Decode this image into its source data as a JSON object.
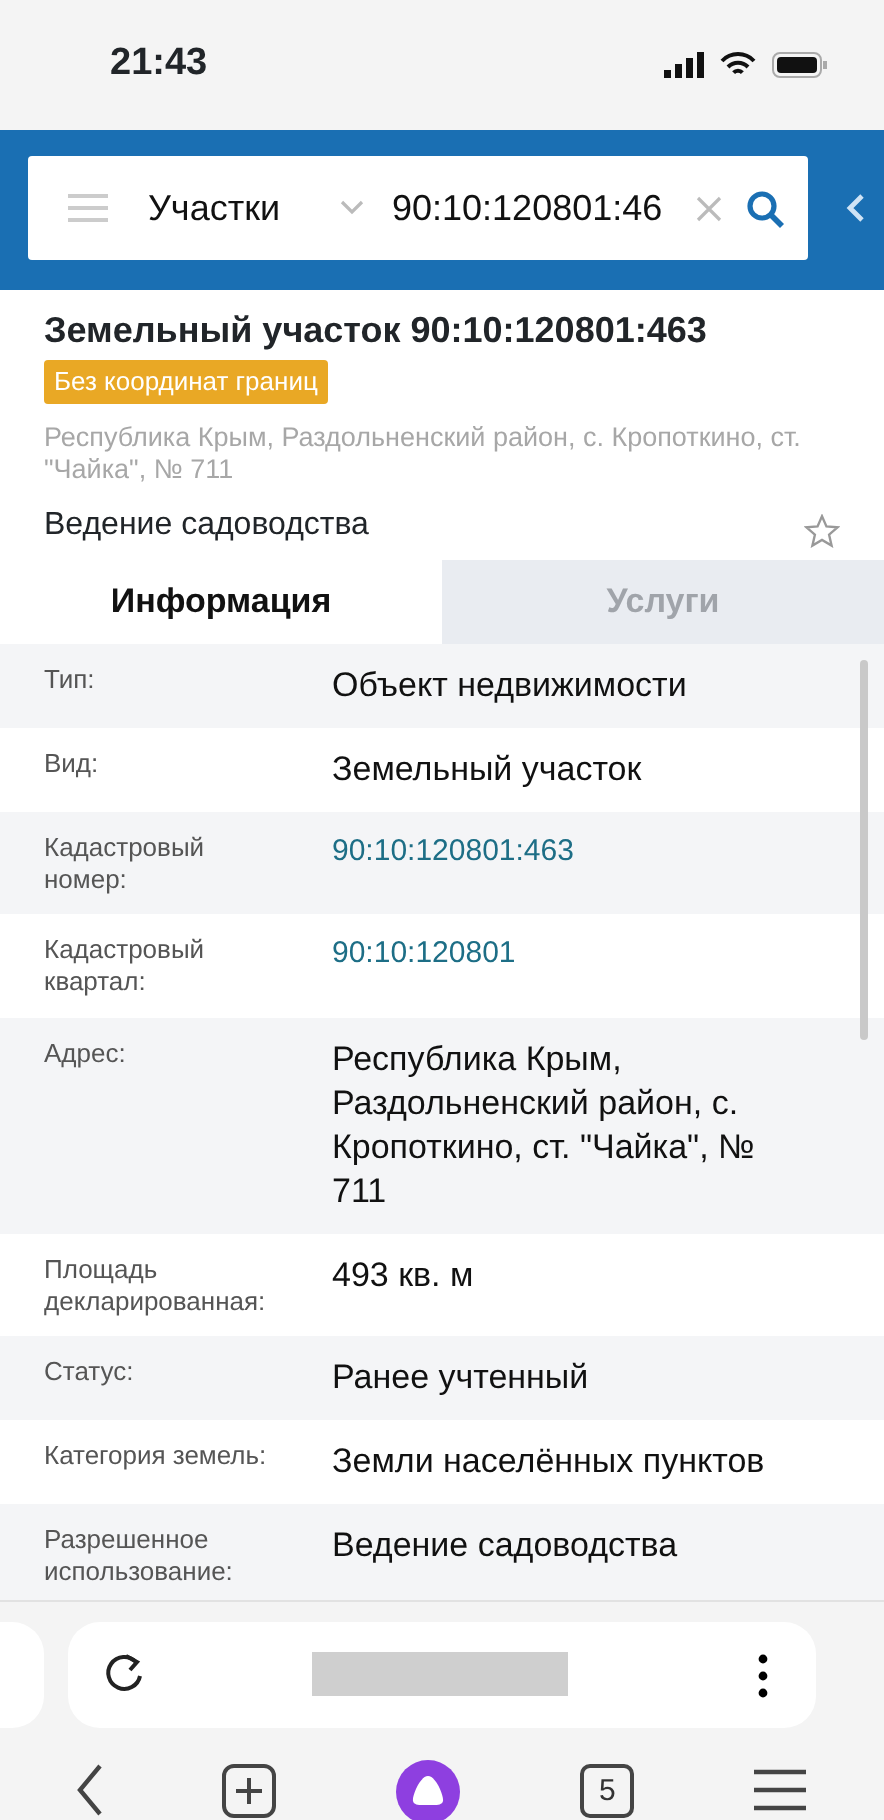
{
  "status_bar": {
    "time": "21:43"
  },
  "search": {
    "category": "Участки",
    "query": "90:10:120801:46"
  },
  "object": {
    "title": "Земельный участок 90:10:120801:463",
    "badge": "Без координат границ",
    "address": "Республика Крым, Раздольненский район, с. Кропоткино, ст. \"Чайка\", № 711",
    "usage": "Ведение садоводства",
    "favorite": false
  },
  "tabs": [
    {
      "label": "Информация",
      "selected": true
    },
    {
      "label": "Услуги",
      "selected": false
    }
  ],
  "rows": [
    {
      "label": "Тип:",
      "value": "Объект недвижимости",
      "kind": "text"
    },
    {
      "label": "Вид:",
      "value": "Земельный участок",
      "kind": "text"
    },
    {
      "label": "Кадастровый номер:",
      "value": "90:10:120801:463",
      "kind": "link"
    },
    {
      "label": "Кадастровый квартал:",
      "value": "90:10:120801",
      "kind": "link"
    },
    {
      "label": "Адрес:",
      "value": "Республика Крым, Раздольненский район, с. Кропоткино, ст. \"Чайка\", № 711",
      "kind": "text"
    },
    {
      "label": "Площадь декларированная:",
      "value": "493 кв. м",
      "kind": "text"
    },
    {
      "label": "Статус:",
      "value": "Ранее учтенный",
      "kind": "text"
    },
    {
      "label": "Категория земель:",
      "value": "Земли населённых пунктов",
      "kind": "text"
    },
    {
      "label": "Разрешенное использование:",
      "value": "Ведение садоводства",
      "kind": "text"
    }
  ],
  "browser": {
    "tab_count": "5"
  }
}
